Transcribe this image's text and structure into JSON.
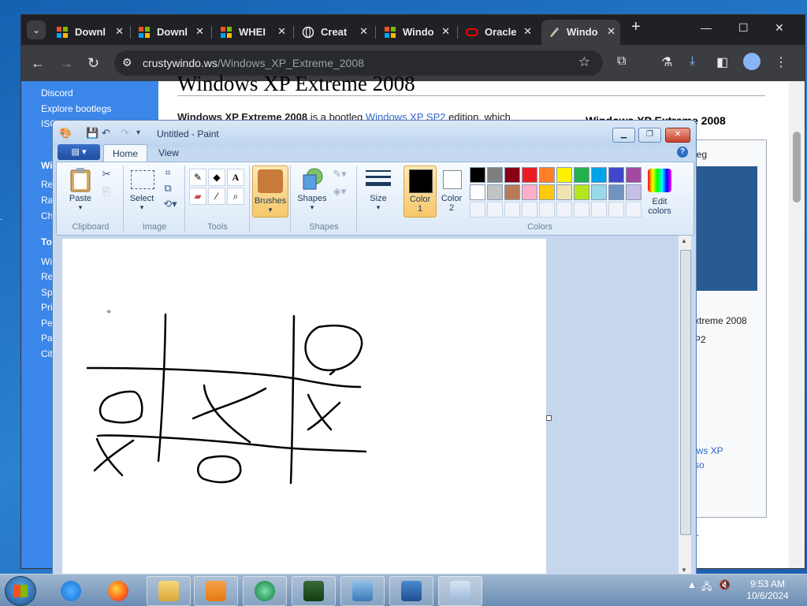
{
  "browser": {
    "tabs": [
      {
        "label": "Downl",
        "icon": "windows-logo-icon"
      },
      {
        "label": "Downl",
        "icon": "windows-logo-icon"
      },
      {
        "label": "WHEI",
        "icon": "windows-logo-icon"
      },
      {
        "label": "Creat",
        "icon": "globe-icon"
      },
      {
        "label": "Windo",
        "icon": "windows-logo-icon"
      },
      {
        "label": "Oracle",
        "icon": "oracle-icon"
      },
      {
        "label": "Windo",
        "icon": "brush-icon",
        "active": true
      }
    ],
    "url_host": "crustywindo.ws",
    "url_path": "/Windows_XP_Extreme_2008"
  },
  "webpage": {
    "sidebar_links": [
      "Discord",
      "Explore bootlegs",
      "ISO"
    ],
    "sidebar_frags": [
      "Wi",
      "Re",
      "Ra",
      "Ch",
      "To",
      "Wi",
      "Re",
      "Sp",
      "Pri",
      "Pe",
      "Pa",
      "Cit"
    ],
    "title": "Windows XP Extreme 2008",
    "intro_bold": "Windows XP Extreme 2008",
    "intro_text": " is a bootleg ",
    "intro_link": "Windows XP SP2",
    "intro_tail": " edition, which",
    "infobox_title": "Windows XP Extreme 2008",
    "infobox_frag1": "leg",
    "infobox_caption": "xtreme 2008",
    "infobox_frag2": "P2",
    "infobox_link1": "ows XP",
    "infobox_link2": "so",
    "page_frag": "l."
  },
  "paint": {
    "title": "Untitled - Paint",
    "tabs": [
      "Home",
      "View"
    ],
    "groups": {
      "clipboard": "Clipboard",
      "image": "Image",
      "tools": "Tools",
      "shapes": "Shapes",
      "colors": "Colors"
    },
    "buttons": {
      "paste": "Paste",
      "select": "Select",
      "brushes": "Brushes",
      "shapes": "Shapes",
      "size": "Size",
      "color1_l1": "Color",
      "color1_l2": "1",
      "color2_l1": "Color",
      "color2_l2": "2",
      "edit_colors_l1": "Edit",
      "edit_colors_l2": "colors"
    },
    "palette_row1": [
      "#000000",
      "#7f7f7f",
      "#880015",
      "#ed1c24",
      "#ff7f27",
      "#fff200",
      "#22b14c",
      "#00a2e8",
      "#3f48cc",
      "#a349a4"
    ],
    "palette_row2": [
      "#ffffff",
      "#c3c3c3",
      "#b97a57",
      "#ffaec9",
      "#ffc90e",
      "#efe4b0",
      "#b5e61d",
      "#99d9ea",
      "#7092be",
      "#c8bfe7"
    ],
    "color1": "#000000",
    "color2": "#ffffff"
  },
  "taskbar": {
    "time": "9:53 AM",
    "date": "10/6/2024",
    "apps": [
      "internet-explorer-icon",
      "firefox-icon",
      "file-explorer-icon",
      "media-player-icon",
      "media-center-icon",
      "task-manager-icon",
      "control-panel-icon",
      "virtualbox-icon",
      "paint-icon"
    ]
  }
}
